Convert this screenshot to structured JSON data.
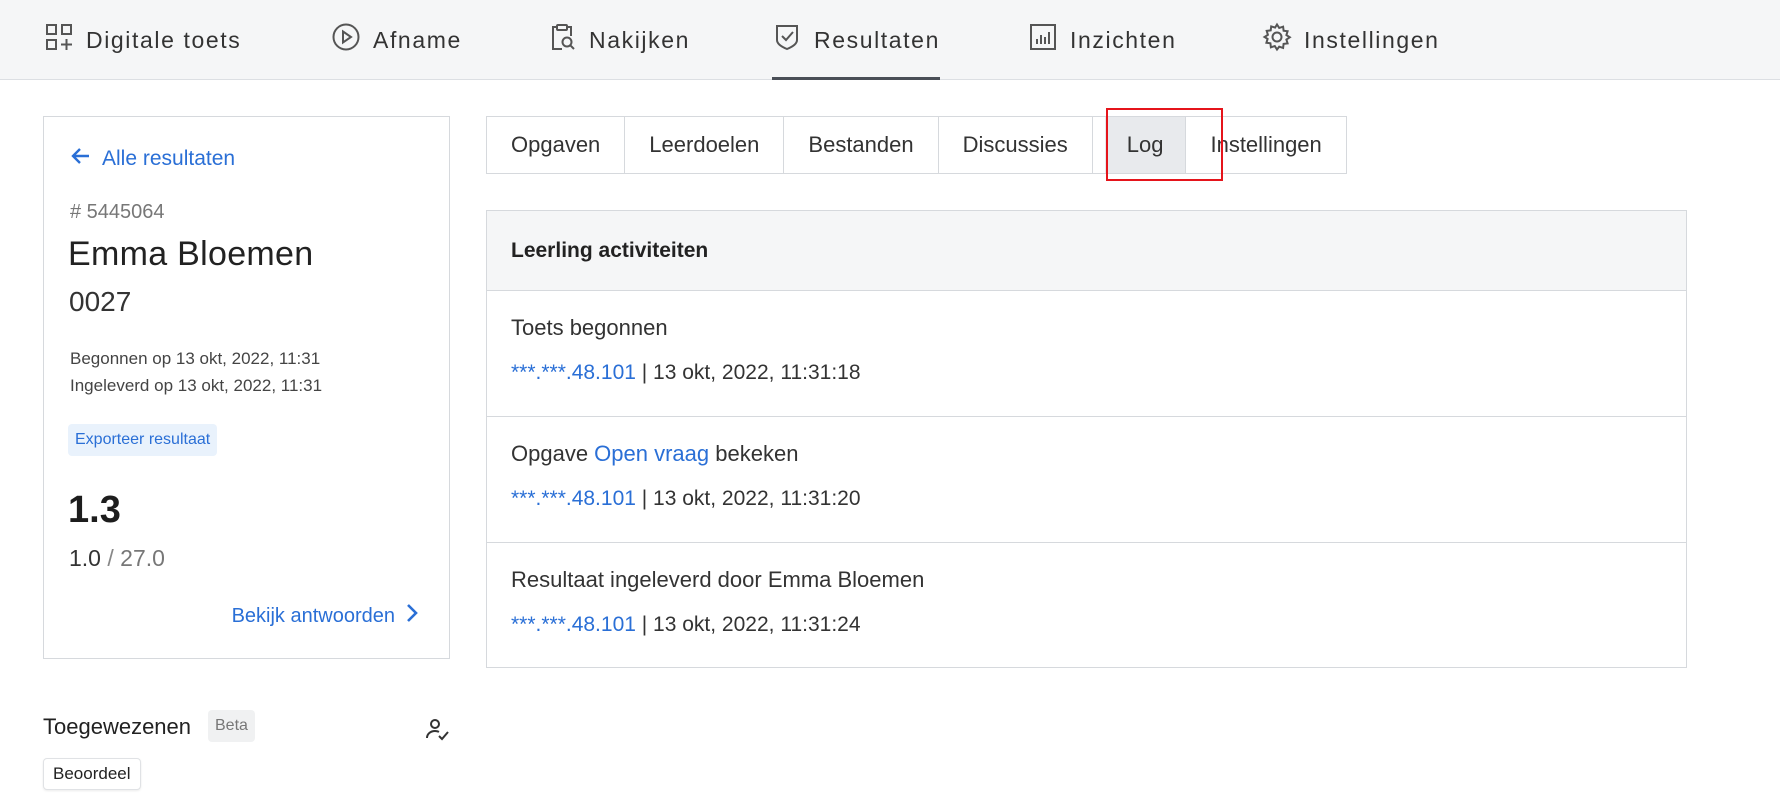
{
  "topnav": {
    "items": [
      {
        "label": "Digitale toets",
        "icon": "dashboard-add-icon"
      },
      {
        "label": "Afname",
        "icon": "play-circle-icon"
      },
      {
        "label": "Nakijken",
        "icon": "clipboard-search-icon"
      },
      {
        "label": "Resultaten",
        "icon": "shield-check-icon",
        "active": true
      },
      {
        "label": "Inzichten",
        "icon": "bar-chart-icon"
      },
      {
        "label": "Instellingen",
        "icon": "gear-icon"
      }
    ]
  },
  "result_card": {
    "back_label": "Alle resultaten",
    "result_id": "# 5445064",
    "student_name": "Emma Bloemen",
    "student_code": "0027",
    "started": "Begonnen op 13 okt, 2022, 11:31",
    "submitted": "Ingeleverd op 13 okt, 2022, 11:31",
    "export_label": "Exporteer resultaat",
    "grade": "1.3",
    "points_scored": "1.0",
    "points_separator": " / ",
    "points_max": "27.0",
    "view_answers_label": "Bekijk antwoorden"
  },
  "assigned": {
    "title": "Toegewezenen",
    "badge": "Beta",
    "button_label": "Beoordeel"
  },
  "tabs": [
    {
      "label": "Opgaven"
    },
    {
      "label": "Leerdoelen"
    },
    {
      "label": "Bestanden"
    },
    {
      "label": "Discussies"
    },
    {
      "label": "Log",
      "active": true
    },
    {
      "label": "Instellingen"
    }
  ],
  "activity": {
    "header": "Leerling activiteiten",
    "entries": [
      {
        "prefix": "Toets begonnen",
        "link": "",
        "suffix": "",
        "ip": "***.***.48.101",
        "timestamp": " | 13 okt, 2022, 11:31:18"
      },
      {
        "prefix": "Opgave ",
        "link": "Open vraag",
        "suffix": " bekeken",
        "ip": "***.***.48.101",
        "timestamp": " | 13 okt, 2022, 11:31:20"
      },
      {
        "prefix": "Resultaat ingeleverd door Emma Bloemen",
        "link": "",
        "suffix": "",
        "ip": "***.***.48.101",
        "timestamp": " | 13 okt, 2022, 11:31:24"
      }
    ]
  },
  "colors": {
    "accent": "#2a6fd6",
    "highlight": "#e5141b"
  }
}
